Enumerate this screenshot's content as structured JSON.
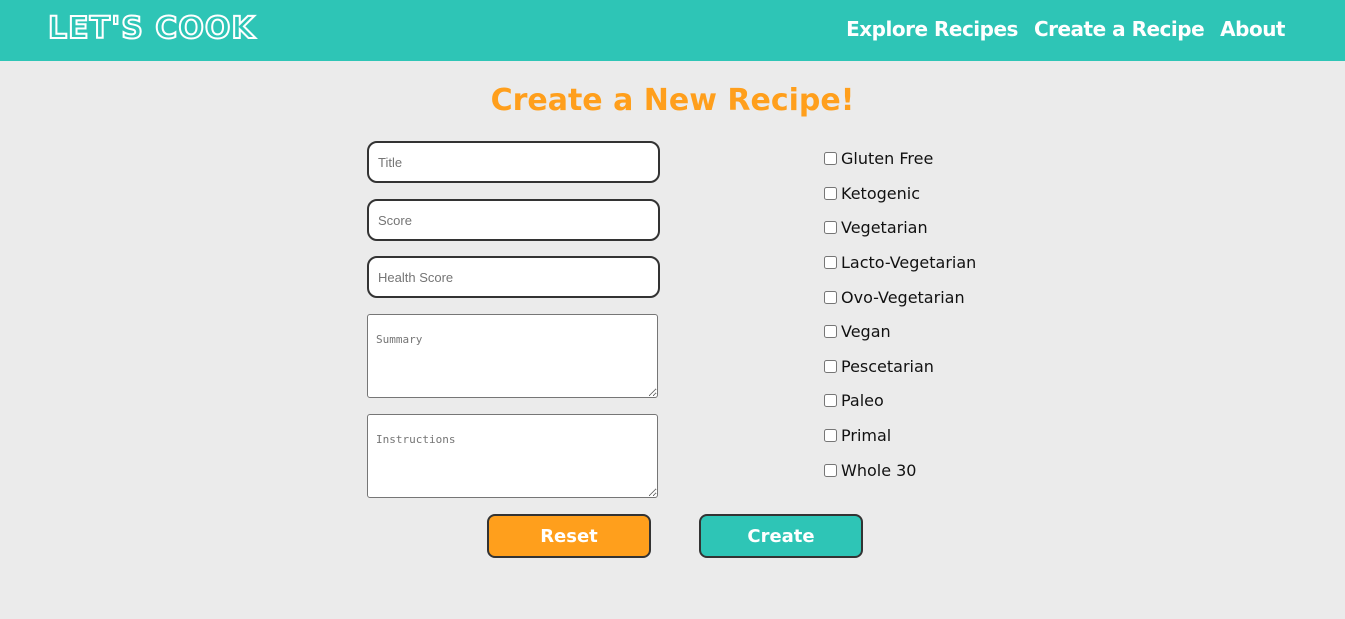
{
  "header": {
    "logo_text": "LET'S COOK",
    "nav": [
      {
        "label": "Explore Recipes"
      },
      {
        "label": "Create a Recipe"
      },
      {
        "label": "About"
      }
    ]
  },
  "main": {
    "title": "Create a New Recipe!",
    "fields": {
      "title": {
        "placeholder": "Title",
        "value": ""
      },
      "score": {
        "placeholder": "Score",
        "value": ""
      },
      "health_score": {
        "placeholder": "Health Score",
        "value": ""
      },
      "summary": {
        "placeholder": "Summary",
        "value": ""
      },
      "instructions": {
        "placeholder": "Instructions",
        "value": ""
      }
    },
    "diets": [
      {
        "label": "Gluten Free",
        "checked": false
      },
      {
        "label": "Ketogenic",
        "checked": false
      },
      {
        "label": "Vegetarian",
        "checked": false
      },
      {
        "label": "Lacto-Vegetarian",
        "checked": false
      },
      {
        "label": "Ovo-Vegetarian",
        "checked": false
      },
      {
        "label": "Vegan",
        "checked": false
      },
      {
        "label": "Pescetarian",
        "checked": false
      },
      {
        "label": "Paleo",
        "checked": false
      },
      {
        "label": "Primal",
        "checked": false
      },
      {
        "label": "Whole 30",
        "checked": false
      }
    ],
    "buttons": {
      "reset_label": "Reset",
      "create_label": "Create"
    }
  },
  "colors": {
    "primary": "#2ec5b6",
    "accent": "#ff9f1c",
    "background": "#ebebeb"
  }
}
